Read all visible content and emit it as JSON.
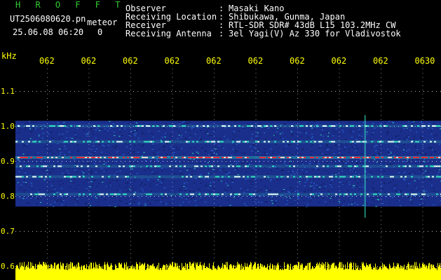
{
  "header": {
    "brand": "H R O F F T",
    "filename": "UT2506080620.pn",
    "mode": "meteor",
    "datetime": "25.06.08 06:20",
    "datetime_tail": "0",
    "fields": [
      {
        "label": "Observer",
        "value": "Masaki Kano"
      },
      {
        "label": "Receiving Location",
        "value": "Shibukawa, Gunma, Japan"
      },
      {
        "label": "Receiver",
        "value": "RTL-SDR SDR# 43dB L15 103.2MHz CW"
      },
      {
        "label": "Receiving Antenna",
        "value": "3el Yagi(V) Az 330 for Vladivostok"
      }
    ],
    "separator": ":"
  },
  "chart_data": {
    "type": "heatmap",
    "ylabel": "kHz",
    "yticks": [
      "1.1",
      "1.0",
      "0.9",
      "0.8",
      "0.7",
      "0.6"
    ],
    "ylim": [
      0.6,
      1.15
    ],
    "xticks": [
      "062",
      "062",
      "062",
      "062",
      "062",
      "062",
      "062",
      "062",
      "062",
      "0630"
    ],
    "grid": true,
    "signal_lines_khz": [
      {
        "freq": 1.0,
        "intensity": 0.45
      },
      {
        "freq": 0.955,
        "intensity": 0.55
      },
      {
        "freq": 0.91,
        "intensity": 1.0
      },
      {
        "freq": 0.885,
        "intensity": 0.5
      },
      {
        "freq": 0.855,
        "intensity": 0.55
      },
      {
        "freq": 0.805,
        "intensity": 0.5
      }
    ],
    "band_khz": [
      0.77,
      1.015
    ],
    "meteor_spike_minute_fraction": 0.82,
    "colors": {
      "background": "#000000",
      "band": "#1a2f8c",
      "grid": "#ffffff",
      "strong": "#ff2a3a",
      "mid": "#33e0c0",
      "low": "#2a6fe0",
      "audio": "#ffff00"
    }
  }
}
